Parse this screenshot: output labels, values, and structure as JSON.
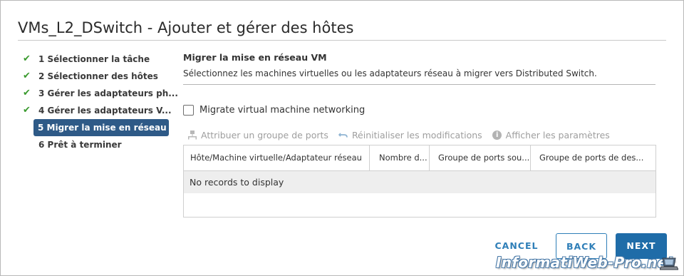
{
  "dialog": {
    "title": "VMs_L2_DSwitch - Ajouter et gérer des hôtes"
  },
  "steps": [
    {
      "label": "1 Sélectionner la tâche",
      "done": true
    },
    {
      "label": "2 Sélectionner des hôtes",
      "done": true
    },
    {
      "label": "3 Gérer les adaptateurs ph...",
      "done": true
    },
    {
      "label": "4 Gérer les adaptateurs V...",
      "done": true
    },
    {
      "label": "5 Migrer la mise en réseau ...",
      "active": true
    },
    {
      "label": "6 Prêt à terminer"
    }
  ],
  "content": {
    "title": "Migrer la mise en réseau VM",
    "description": "Sélectionnez les machines virtuelles ou les adaptateurs réseau à migrer vers Distributed Switch.",
    "checkbox_label": "Migrate virtual machine networking",
    "checkbox_checked": false
  },
  "toolbar": {
    "assign_label": "Attribuer un groupe de ports",
    "reset_label": "Réinitialiser les modifications",
    "settings_label": "Afficher les paramètres"
  },
  "grid": {
    "columns": [
      "Hôte/Machine virtuelle/Adaptateur réseau",
      "Nombre d...",
      "Groupe de ports sou...",
      "Groupe de ports de des..."
    ],
    "empty_text": "No records to display"
  },
  "buttons": {
    "cancel": "CANCEL",
    "back": "BACK",
    "next": "NEXT"
  },
  "watermark": "InformatiWeb-Pro.net",
  "colors": {
    "accent": "#1f6ca8",
    "active_step": "#2e5a87",
    "check": "#3a9a2e"
  }
}
